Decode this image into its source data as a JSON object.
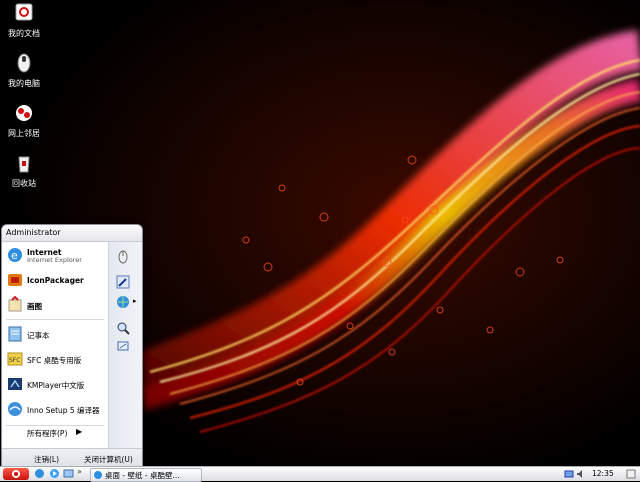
{
  "desktop": {
    "icons": [
      {
        "label": "我的文档",
        "icon": "my-documents-icon"
      },
      {
        "label": "我的电脑",
        "icon": "my-computer-icon"
      },
      {
        "label": "网上邻居",
        "icon": "network-places-icon"
      },
      {
        "label": "回收站",
        "icon": "recycle-bin-icon"
      }
    ]
  },
  "start_menu": {
    "user": "Administrator",
    "items": [
      {
        "title": "Internet",
        "subtitle": "Internet Explorer",
        "icon": "internet-explorer-icon"
      },
      {
        "title": "IconPackager",
        "icon": "iconpackager-icon"
      },
      {
        "title": "画图",
        "icon": "paint-icon"
      },
      {
        "title": "记事本",
        "icon": "notepad-icon"
      },
      {
        "title": "SFC 桌酷专用版",
        "icon": "sfc-icon"
      },
      {
        "title": "KMPlayer中文版",
        "icon": "kmplayer-icon"
      },
      {
        "title": "Inno Setup 5 编译器",
        "icon": "inno-setup-icon"
      }
    ],
    "right_icons": [
      "mouse-icon",
      "pen-icon",
      "network-globe-icon",
      "search-icon",
      "run-icon"
    ],
    "all_programs": "所有程序(P)",
    "logout": "注销(L)",
    "shutdown": "关闭计算机(U)"
  },
  "taskbar": {
    "task_label": "桌面 - 壁纸 - 桌酷壁...",
    "clock": "12:35"
  },
  "colors": {
    "accent": "#ff5a20",
    "start_red": "#d8160c",
    "wallpaper_bg": "#000000"
  }
}
